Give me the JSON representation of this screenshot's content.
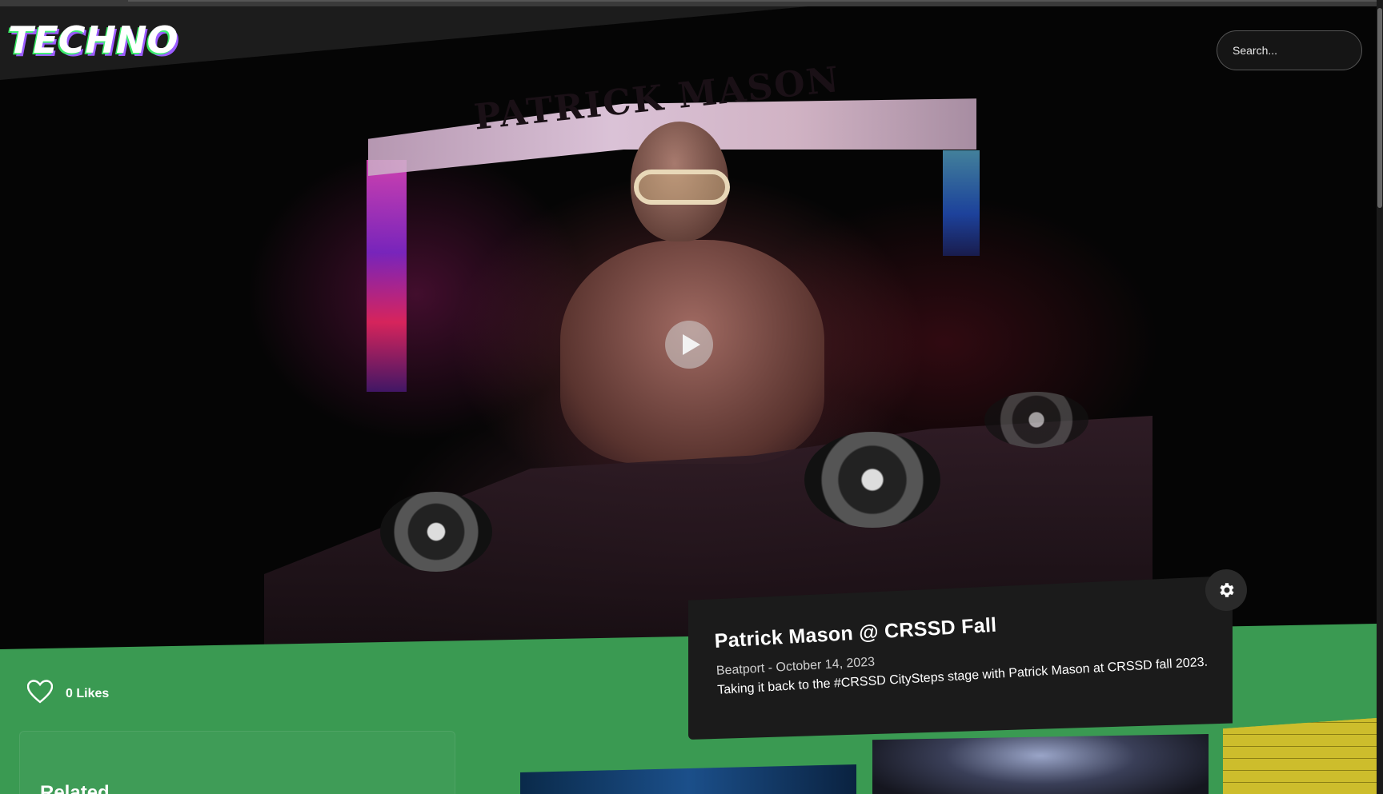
{
  "brand": {
    "logo_text": "TECHNO"
  },
  "search": {
    "placeholder": "Search..."
  },
  "hero": {
    "banner_text": "PATRICK MASON",
    "likes_label": "0 Likes"
  },
  "card": {
    "title": "Patrick Mason @ CRSSD Fall",
    "meta": "Beatport - October 14, 2023",
    "description": "Taking it back to the #CRSSD CitySteps stage with Patrick Mason at CRSSD fall 2023."
  },
  "related": {
    "title": "Related"
  },
  "icons": {
    "search": "search-icon",
    "heart": "heart-icon",
    "play": "play-icon",
    "settings": "gear-icon"
  },
  "colors": {
    "accent_green": "#3a9a52",
    "card_bg": "#1b1b1b",
    "logo_purple": "#9b5cff",
    "logo_green": "#39ff6a"
  }
}
